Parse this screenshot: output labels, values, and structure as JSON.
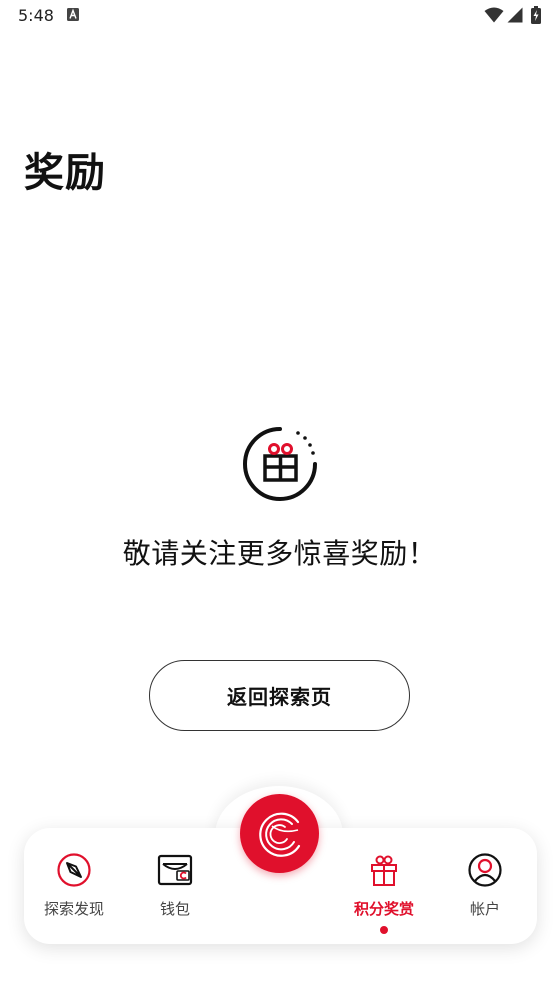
{
  "status_bar": {
    "time": "5:48",
    "icons": [
      "a-notification-icon",
      "wifi-icon",
      "signal-icon",
      "battery-icon"
    ]
  },
  "page": {
    "title": "奖励"
  },
  "empty_state": {
    "icon": "gift-icon",
    "message": "敬请关注更多惊喜奖励！",
    "button_label": "返回探索页"
  },
  "tab_bar": {
    "items": [
      {
        "label": "探索发现",
        "icon": "compass-icon",
        "active": false
      },
      {
        "label": "钱包",
        "icon": "wallet-icon",
        "active": false
      },
      {
        "label": "积分奖赏",
        "icon": "gift-icon",
        "active": true
      },
      {
        "label": "帐户",
        "icon": "user-icon",
        "active": false
      }
    ],
    "center_button_icon": "brand-logo-icon"
  },
  "colors": {
    "accent": "#e0102c",
    "text": "#111111",
    "muted": "#444444",
    "background": "#ffffff"
  }
}
